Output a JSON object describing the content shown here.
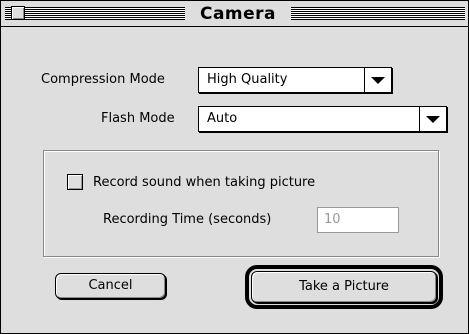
{
  "window": {
    "title": "Camera"
  },
  "compression": {
    "label": "Compression Mode",
    "value": "High Quality"
  },
  "flash": {
    "label": "Flash Mode",
    "value": "Auto"
  },
  "sound": {
    "checkbox_label": "Record sound when taking picture",
    "checked": false,
    "time_label": "Recording Time (seconds)",
    "time_value": "10"
  },
  "buttons": {
    "cancel": "Cancel",
    "take_picture": "Take a Picture"
  }
}
